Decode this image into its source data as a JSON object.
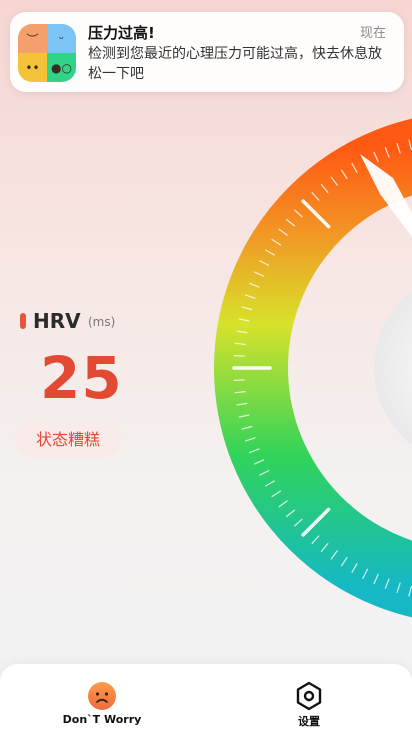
{
  "notification": {
    "title": "压力过高!",
    "time": "现在",
    "body": "检测到您最近的心理压力可能过高，快去休息放松一下吧",
    "icon": "app-emoji-faces-icon"
  },
  "metric": {
    "label": "HRV",
    "unit": "(ms)",
    "value": "25",
    "status": "状态糟糕",
    "status_color": "#e24a33"
  },
  "gauge": {
    "value": 25,
    "colors": [
      "#ff5a14",
      "#f5a623",
      "#d8e82f",
      "#31d35a",
      "#15b8c4"
    ]
  },
  "nav": {
    "home_label": "Don`T Worry",
    "settings_label": "设置",
    "home_icon": "sad-face-icon",
    "settings_icon": "gear-icon"
  }
}
